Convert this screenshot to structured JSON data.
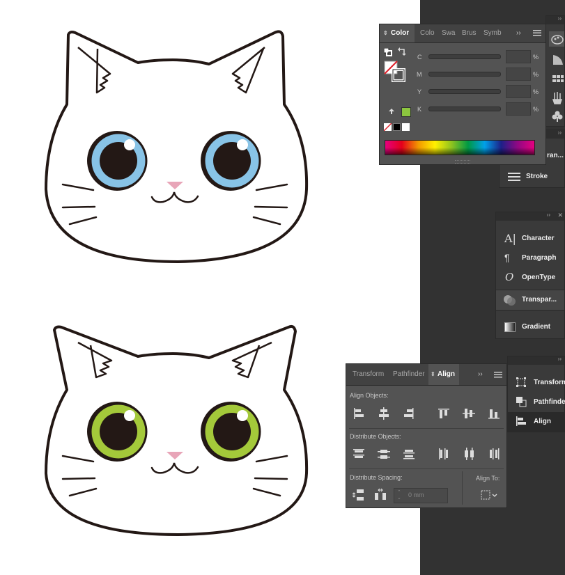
{
  "color_panel": {
    "tabs": [
      "Color",
      "Colo",
      "Swa",
      "Brus",
      "Symb"
    ],
    "channels": [
      "C",
      "M",
      "Y",
      "K"
    ],
    "percent": "%"
  },
  "right_strip": {
    "transform_label": "ran...",
    "stroke_label": "Stroke"
  },
  "type_panel": {
    "items": [
      "Character",
      "Paragraph",
      "OpenType",
      "Transpar...",
      "Gradient"
    ]
  },
  "align_panel": {
    "tabs": [
      "Transform",
      "Pathfinder",
      "Align"
    ],
    "align_objects": "Align Objects:",
    "distribute_objects": "Distribute Objects:",
    "distribute_spacing": "Distribute Spacing:",
    "align_to": "Align To:",
    "spacing_value": "0 mm"
  },
  "collapsed_panel": {
    "items": [
      "Transform",
      "Pathfinder",
      "Align"
    ]
  },
  "artwork": {
    "top_cat_eye_color": "#88c3e6",
    "bottom_cat_eye_color": "#a4c93a",
    "nose_color": "#e8a5b8",
    "k_swatch_color": "#8cc63f"
  }
}
